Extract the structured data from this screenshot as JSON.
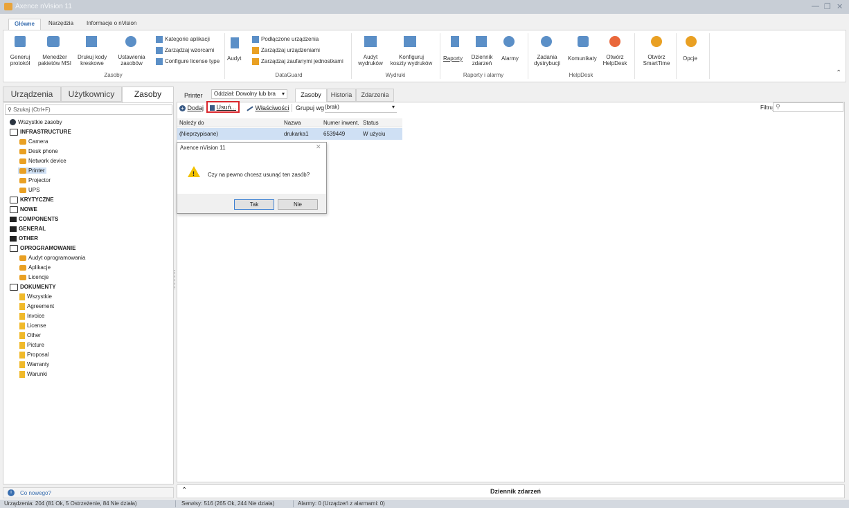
{
  "window": {
    "title": "Axence nVision 11"
  },
  "ribbon_tabs": [
    "Główne",
    "Narzędzia",
    "Informacje o nVision"
  ],
  "ribbon": {
    "zasoby": [
      "Generuj\nprotokół",
      "Menedżer\npakietów MSI",
      "Drukuj kody\nkreskowe",
      "Ustawienia\nzasobów"
    ],
    "zasoby_small": [
      "Kategorie aplikacji",
      "Zarządzaj wzorcami",
      "Configure license type"
    ],
    "zasoby_group": "Zasoby",
    "dataguard_audyt": "Audyt",
    "dataguard_small": [
      "Podłączone urządzenia",
      "Zarządzaj urządzeniami",
      "Zarządzaj zaufanymi jednostkami"
    ],
    "dataguard_group": "DataGuard",
    "wydruki": [
      "Audyt\nwydruków",
      "Konfiguruj\nkoszty wydruków"
    ],
    "wydruki_group": "Wydruki",
    "raporty": [
      "Raporty",
      "Dziennik\nzdarzeń",
      "Alarmy"
    ],
    "raporty_group": "Raporty i alarmy",
    "helpdesk": [
      "Zadania\ndystrybucji",
      "Komunikaty",
      "Otwórz\nHelpDesk"
    ],
    "helpdesk_group": "HelpDesk",
    "smarttime": "Otwórz\nSmartTime",
    "opcje": "Opcje"
  },
  "left_tabs": [
    "Urządzenia",
    "Użytkownicy",
    "Zasoby"
  ],
  "search_placeholder": "Szukaj (Ctrl+F)",
  "tree": [
    {
      "label": "Wszystkie zasoby",
      "level": 0,
      "icon": "globe",
      "bold": false
    },
    {
      "label": "INFRASTRUCTURE",
      "level": 0,
      "icon": "folder-open",
      "bold": true
    },
    {
      "label": "Camera",
      "level": 1,
      "icon": "object",
      "bold": false
    },
    {
      "label": "Desk phone",
      "level": 1,
      "icon": "object",
      "bold": false
    },
    {
      "label": "Network device",
      "level": 1,
      "icon": "object",
      "bold": false
    },
    {
      "label": "Printer",
      "level": 1,
      "icon": "object",
      "bold": false,
      "selected": true
    },
    {
      "label": "Projector",
      "level": 1,
      "icon": "object",
      "bold": false
    },
    {
      "label": "UPS",
      "level": 1,
      "icon": "object",
      "bold": false
    },
    {
      "label": "KRYTYCZNE",
      "level": 0,
      "icon": "folder-open",
      "bold": true
    },
    {
      "label": "NOWE",
      "level": 0,
      "icon": "folder-open",
      "bold": true
    },
    {
      "label": "COMPONENTS",
      "level": 0,
      "icon": "folder-closed",
      "bold": true
    },
    {
      "label": "GENERAL",
      "level": 0,
      "icon": "folder-closed",
      "bold": true
    },
    {
      "label": "OTHER",
      "level": 0,
      "icon": "folder-closed",
      "bold": true
    },
    {
      "label": "OPROGRAMOWANIE",
      "level": 0,
      "icon": "folder-open",
      "bold": true
    },
    {
      "label": "Audyt oprogramowania",
      "level": 1,
      "icon": "app",
      "bold": false
    },
    {
      "label": "Aplikacje",
      "level": 1,
      "icon": "app",
      "bold": false
    },
    {
      "label": "Licencje",
      "level": 1,
      "icon": "license",
      "bold": false
    },
    {
      "label": "DOKUMENTY",
      "level": 0,
      "icon": "folder-open",
      "bold": true
    },
    {
      "label": "Wszystkie",
      "level": 1,
      "icon": "doc",
      "bold": false
    },
    {
      "label": "Agreement",
      "level": 1,
      "icon": "doc",
      "bold": false
    },
    {
      "label": "Invoice",
      "level": 1,
      "icon": "doc",
      "bold": false
    },
    {
      "label": "License",
      "level": 1,
      "icon": "doc",
      "bold": false
    },
    {
      "label": "Other",
      "level": 1,
      "icon": "doc",
      "bold": false
    },
    {
      "label": "Picture",
      "level": 1,
      "icon": "doc",
      "bold": false
    },
    {
      "label": "Proposal",
      "level": 1,
      "icon": "doc",
      "bold": false
    },
    {
      "label": "Warranty",
      "level": 1,
      "icon": "doc",
      "bold": false
    },
    {
      "label": "Warunki",
      "level": 1,
      "icon": "doc",
      "bold": false
    }
  ],
  "whats_new": "Co nowego?",
  "filter": {
    "label": "Printer",
    "value": "Oddział: Dowolny lub bra"
  },
  "content_tabs": [
    "Zasoby",
    "Historia",
    "Zdarzenia"
  ],
  "toolbar": {
    "add": "Dodaj",
    "delete": "Usuń...",
    "props": "Właściwości",
    "group_label": "Grupuj wg",
    "group_value": "(brak)",
    "filter": "Filtruj"
  },
  "grid": {
    "headers": [
      "Należy do",
      "Nazwa",
      "Numer inwent.",
      "Status"
    ],
    "row": [
      "(Nieprzypisane)",
      "drukarka1",
      "6539449",
      "W użyciu"
    ]
  },
  "dialog": {
    "title": "Axence nVision 11",
    "message": "Czy na pewno chcesz usunąć ten zasób?",
    "yes": "Tak",
    "no": "Nie"
  },
  "log_title": "Dziennik zdarzeń",
  "status": {
    "devices": "Urządzenia: 204 (81 Ok, 5 Ostrzeżenie, 84 Nie działa)",
    "services": "Serwisy: 516 (265 Ok, 244 Nie działa)",
    "alarms": "Alarmy: 0 (Urządzeń z alarmami: 0)"
  },
  "colors": {
    "accent": "#3a6fb0",
    "selection": "#cfe0f4",
    "highlight": "#d9262c",
    "warning": "#f2c200"
  }
}
